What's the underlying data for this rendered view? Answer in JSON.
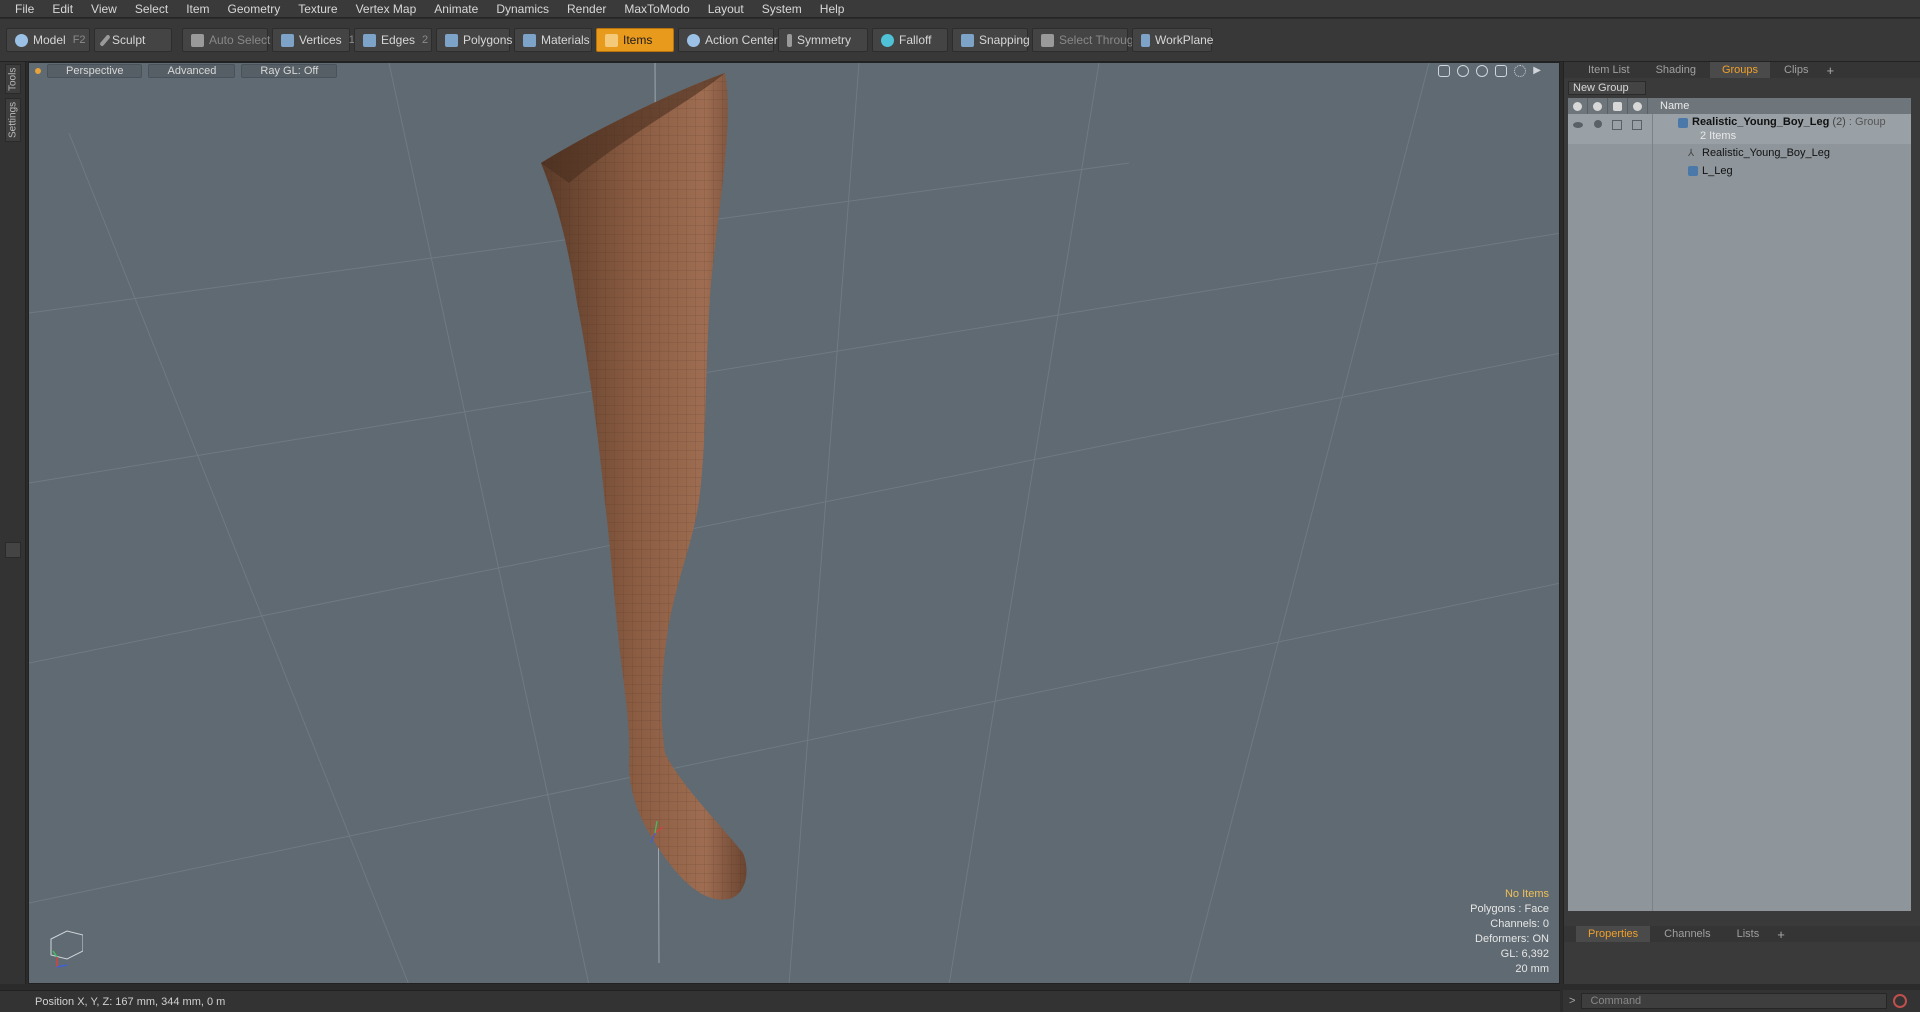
{
  "menu": [
    "File",
    "Edit",
    "View",
    "Select",
    "Item",
    "Geometry",
    "Texture",
    "Vertex Map",
    "Animate",
    "Dynamics",
    "Render",
    "MaxToModo",
    "Layout",
    "System",
    "Help"
  ],
  "toolbar": {
    "model": "Model",
    "model_key": "F2",
    "sculpt": "Sculpt",
    "auto_select": "Auto Select",
    "vertices": "Vertices",
    "vertices_key": "1",
    "edges": "Edges",
    "edges_key": "2",
    "polygons": "Polygons",
    "materials": "Materials",
    "items": "Items",
    "action_center": "Action Center",
    "symmetry": "Symmetry",
    "falloff": "Falloff",
    "snapping": "Snapping",
    "select_through": "Select Through",
    "workplane": "WorkPlane"
  },
  "left_tabs": [
    "Tools",
    "Settings"
  ],
  "viewport": {
    "view": "Perspective",
    "shading": "Advanced",
    "raygl": "Ray GL: Off",
    "info": {
      "items": "No Items",
      "polygons": "Polygons : Face",
      "channels": "Channels: 0",
      "deformers": "Deformers: ON",
      "gl": "GL: 6,392",
      "unit": "20 mm"
    }
  },
  "right_panel": {
    "tabs": [
      "Item List",
      "Shading",
      "Groups",
      "Clips"
    ],
    "active_tab": "Groups",
    "new_group": "New Group",
    "col_name": "Name",
    "group": {
      "name": "Realistic_Young_Boy_Leg",
      "count": "(2)",
      "type": ": Group",
      "sub": "2 Items",
      "children": [
        "Realistic_Young_Boy_Leg",
        "L_Leg"
      ]
    },
    "bottom_tabs": [
      "Properties",
      "Channels",
      "Lists"
    ],
    "command_placeholder": "Command"
  },
  "status": {
    "position": "Position X, Y, Z:  167 mm, 344 mm, 0 m"
  },
  "colors": {
    "accent": "#e89a1c",
    "viewport_bg": "#5f6a72",
    "skin": "#7a5038"
  }
}
